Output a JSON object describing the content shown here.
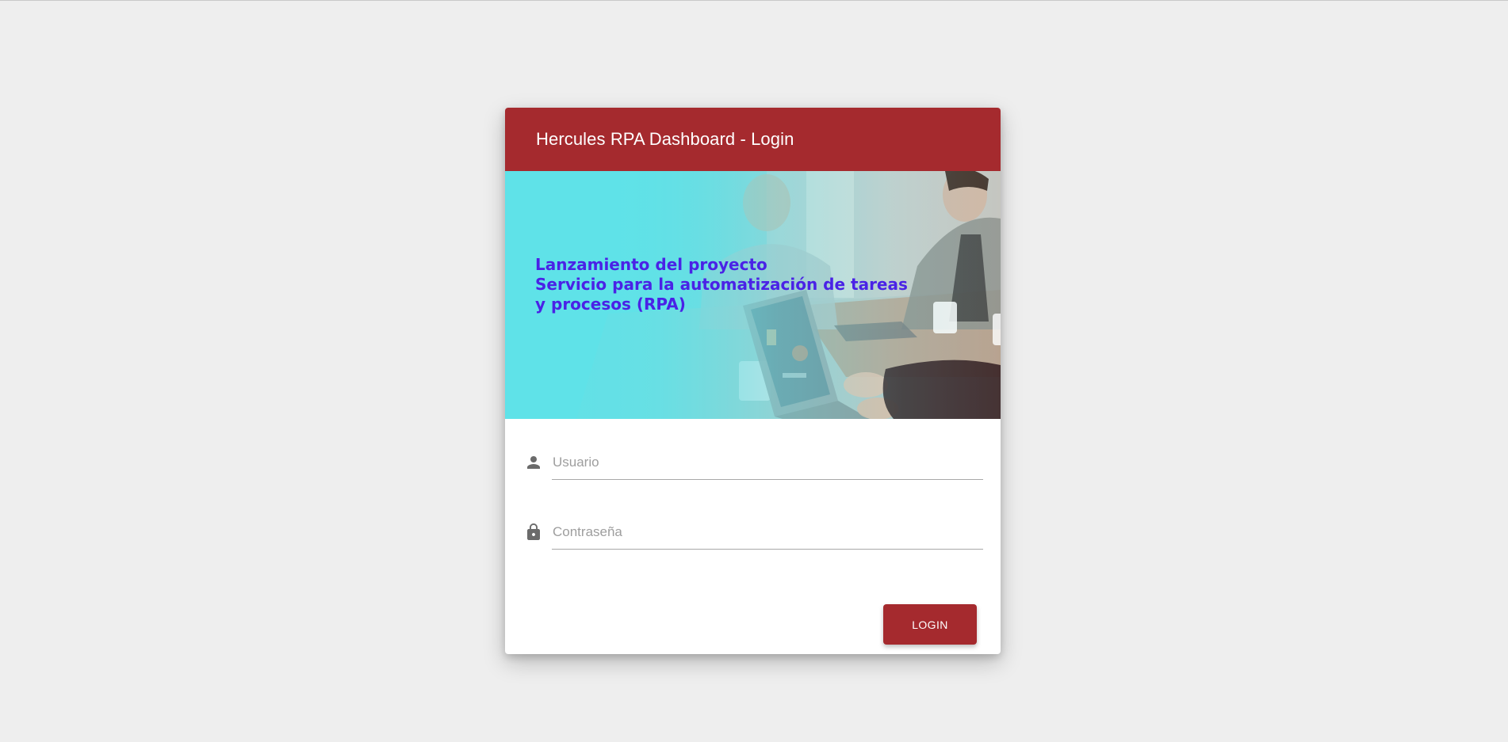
{
  "card": {
    "title": "Hercules RPA Dashboard - Login"
  },
  "banner": {
    "lines": [
      "Lanzamiento del proyecto",
      "Servicio para la automatización de tareas",
      "y procesos  (RPA)"
    ],
    "text_color": "#4a22e6",
    "background_accent": "#5fe2e8"
  },
  "form": {
    "username": {
      "placeholder": "Usuario",
      "value": "",
      "icon": "person-icon"
    },
    "password": {
      "placeholder": "Contraseña",
      "value": "",
      "icon": "lock-icon"
    },
    "submit_label": "LOGIN"
  },
  "colors": {
    "brand": "#a52a2e",
    "page_background": "#eeeeee"
  }
}
